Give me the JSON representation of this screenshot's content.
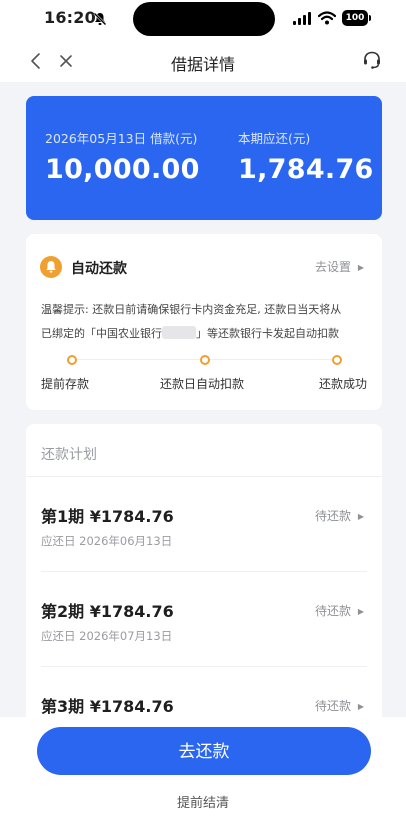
{
  "status_bar": {
    "time": "16:20",
    "battery": "100"
  },
  "nav": {
    "title": "借据详情"
  },
  "loan": {
    "date_label": "2026年05月13日 借款(元)",
    "amount": "10,000.00",
    "due_label": "本期应还(元)",
    "due_amount": "1,784.76"
  },
  "auto_repay": {
    "title": "自动还款",
    "setup_link": "去设置",
    "tip_line1": "温馨提示: 还款日前请确保银行卡内资金充足, 还款日当天将从",
    "tip_line2_prefix": "已绑定的「中国农业银行",
    "tip_line2_suffix": "」等还款银行卡发起自动扣款",
    "steps": [
      "提前存款",
      "还款日自动扣款",
      "还款成功"
    ]
  },
  "plan": {
    "title": "还款计划",
    "rows": [
      {
        "title": "第1期 ¥1784.76",
        "date": "应还日 2026年06月13日",
        "status": "待还款"
      },
      {
        "title": "第2期 ¥1784.76",
        "date": "应还日 2026年07月13日",
        "status": "待还款"
      },
      {
        "title": "第3期 ¥1784.76",
        "date": "",
        "status": "待还款"
      }
    ]
  },
  "actions": {
    "repay": "去还款",
    "early_settle": "提前结清"
  },
  "colors": {
    "primary": "#2a66f0",
    "accent": "#f0a030",
    "background": "#f3f4f7"
  }
}
